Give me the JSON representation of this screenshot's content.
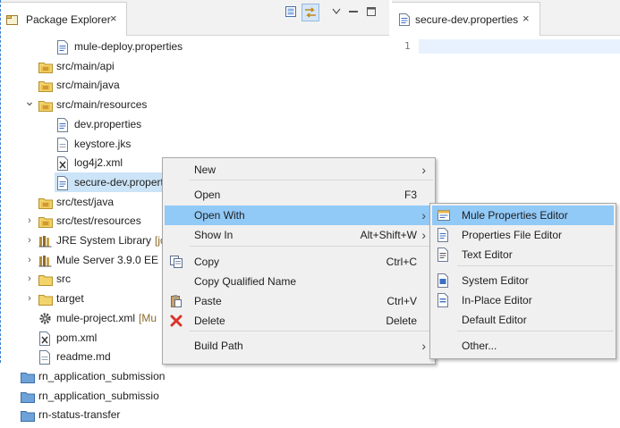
{
  "package_explorer": {
    "tab_label": "Package Explorer",
    "close_glyph": "×",
    "tree": [
      {
        "label": "mule-deploy.properties",
        "decor": "",
        "icon": "properties-file-icon",
        "chevron": ""
      },
      {
        "label": "src/main/api",
        "decor": "",
        "icon": "source-folder-icon",
        "chevron": ""
      },
      {
        "label": "src/main/java",
        "decor": "",
        "icon": "source-folder-icon",
        "chevron": ""
      },
      {
        "label": "src/main/resources",
        "decor": "",
        "icon": "source-folder-icon",
        "chevron": "expanded"
      },
      {
        "label": "dev.properties",
        "decor": "",
        "icon": "properties-file-icon",
        "chevron": ""
      },
      {
        "label": "keystore.jks",
        "decor": "",
        "icon": "file-icon",
        "chevron": ""
      },
      {
        "label": "log4j2.xml",
        "decor": "",
        "icon": "xml-file-icon",
        "chevron": ""
      },
      {
        "label": "secure-dev.propertie",
        "decor": "",
        "icon": "properties-file-icon",
        "chevron": "",
        "selected": true
      },
      {
        "label": "src/test/java",
        "decor": "",
        "icon": "source-folder-icon",
        "chevron": ""
      },
      {
        "label": "src/test/resources",
        "decor": "",
        "icon": "source-folder-icon",
        "chevron": "collapsed"
      },
      {
        "label": "JRE System Library",
        "decor": "[jdk",
        "icon": "library-icon",
        "chevron": "collapsed"
      },
      {
        "label": "Mule Server 3.9.0 EE",
        "decor": "",
        "icon": "library-icon",
        "chevron": "collapsed"
      },
      {
        "label": "src",
        "decor": "",
        "icon": "folder-icon",
        "chevron": "collapsed"
      },
      {
        "label": "target",
        "decor": "",
        "icon": "folder-icon",
        "chevron": "collapsed"
      },
      {
        "label": "mule-project.xml",
        "decor": "[Mu",
        "icon": "gear-icon",
        "chevron": ""
      },
      {
        "label": "pom.xml",
        "decor": "",
        "icon": "xml-file-icon",
        "chevron": ""
      },
      {
        "label": "readme.md",
        "decor": "",
        "icon": "file-icon",
        "chevron": ""
      },
      {
        "label": "rn_application_submission",
        "decor": "",
        "icon": "project-icon",
        "chevron": ""
      },
      {
        "label": "rn_application_submissio",
        "decor": "",
        "icon": "project-icon",
        "chevron": ""
      },
      {
        "label": "rn-status-transfer",
        "decor": "",
        "icon": "project-icon",
        "chevron": ""
      }
    ]
  },
  "editor": {
    "tab_label": "secure-dev.properties",
    "close_glyph": "×",
    "line_number": "1"
  },
  "context_menu": {
    "items": [
      {
        "label": "New",
        "accel": "",
        "submenu": true,
        "icon": ""
      },
      {
        "label": "Open",
        "accel": "F3",
        "submenu": false,
        "icon": ""
      },
      {
        "label": "Open With",
        "accel": "",
        "submenu": true,
        "icon": "",
        "highlighted": true
      },
      {
        "label": "Show In",
        "accel": "Alt+Shift+W",
        "submenu": true,
        "icon": ""
      },
      {
        "label": "Copy",
        "accel": "Ctrl+C",
        "submenu": false,
        "icon": "copy-icon"
      },
      {
        "label": "Copy Qualified Name",
        "accel": "",
        "submenu": false,
        "icon": ""
      },
      {
        "label": "Paste",
        "accel": "Ctrl+V",
        "submenu": false,
        "icon": "paste-icon"
      },
      {
        "label": "Delete",
        "accel": "Delete",
        "submenu": false,
        "icon": "delete-icon"
      },
      {
        "label": "Build Path",
        "accel": "",
        "submenu": true,
        "icon": ""
      }
    ]
  },
  "open_with_submenu": {
    "items": [
      {
        "label": "Mule Properties Editor",
        "icon": "mule-properties-editor-icon",
        "highlighted": true
      },
      {
        "label": "Properties File Editor",
        "icon": "properties-editor-icon"
      },
      {
        "label": "Text Editor",
        "icon": "text-editor-icon"
      },
      {
        "label": "System Editor",
        "icon": "system-editor-icon"
      },
      {
        "label": "In-Place Editor",
        "icon": "in-place-editor-icon"
      },
      {
        "label": "Default Editor",
        "icon": ""
      },
      {
        "label": "Other...",
        "icon": ""
      }
    ]
  },
  "colors": {
    "selection": "#cce4f7",
    "menu_highlight": "#91c9f7",
    "menu_background": "#f0f0f0",
    "current_line": "#e8f2fe"
  }
}
